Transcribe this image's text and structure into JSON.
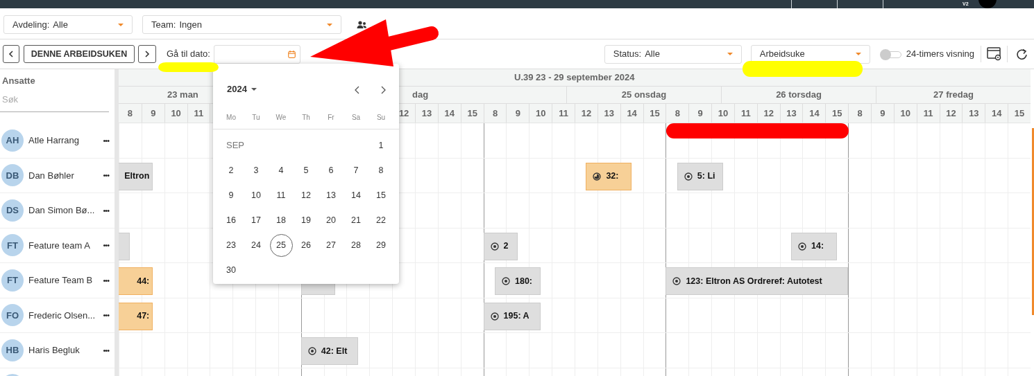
{
  "top_bar": {
    "badge": "V2"
  },
  "filters": [
    {
      "label": "Avdeling:",
      "value": "Alle"
    },
    {
      "label": "Team:",
      "value": "Ingen"
    }
  ],
  "toolbar": {
    "this_week_button": "DENNE ARBEIDSUKEN",
    "goto_label": "Gå til dato:",
    "status": {
      "label": "Status:",
      "value": "Alle"
    },
    "view": {
      "value": "Arbeidsuke"
    },
    "toggle": {
      "label": "24-timers visning",
      "on": false
    }
  },
  "sidebar": {
    "title": "Ansatte",
    "search": {
      "placeholder": "Søk"
    }
  },
  "calendar": {
    "week_title": "U.39 23 - 29 september 2024",
    "days": [
      {
        "label": "23 man",
        "hours": [
          "8",
          "9",
          "10",
          "11"
        ]
      },
      {
        "label": "dag",
        "hours": [
          "12",
          "13",
          "14",
          "15"
        ]
      },
      {
        "label": "25 onsdag",
        "hours": [
          "8",
          "9",
          "10",
          "11",
          "12",
          "13",
          "14",
          "15"
        ]
      },
      {
        "label": "26 torsdag",
        "hours": [
          "8",
          "9",
          "10",
          "11",
          "12",
          "13",
          "14",
          "15"
        ]
      },
      {
        "label": "27 fredag",
        "hours": [
          "8",
          "9",
          "10",
          "11",
          "12",
          "13",
          "14",
          "15"
        ]
      }
    ],
    "rows": [
      {
        "initials": "AH",
        "name": "Atle Harrang",
        "menu": "•••",
        "events": []
      },
      {
        "initials": "DB",
        "name": "Dan Bøhler",
        "menu": "•••",
        "events": [
          {
            "label": "Eltron",
            "kind": "planned"
          },
          {
            "label": "32:",
            "kind": "started"
          },
          {
            "label": "5: Li",
            "kind": "planned"
          }
        ]
      },
      {
        "initials": "DS",
        "name": "Dan Simon Bø...",
        "menu": "•••",
        "events": []
      },
      {
        "initials": "FT",
        "name": "Feature team A",
        "menu": "•••",
        "events": [
          {
            "kind": "planned"
          },
          {
            "label": "2",
            "kind": "planned"
          },
          {
            "label": "14:",
            "kind": "planned"
          }
        ]
      },
      {
        "initials": "FT",
        "name": "Feature Team B",
        "menu": "•••",
        "events": [
          {
            "label": "44:",
            "kind": "started"
          },
          {
            "kind": "planned"
          },
          {
            "label": "180:",
            "kind": "planned"
          },
          {
            "label": "123: Eltron AS Ordreref: Autotest",
            "kind": "planned"
          }
        ]
      },
      {
        "initials": "FO",
        "name": "Frederic Olsen...",
        "menu": "•••",
        "events": [
          {
            "label": "47:",
            "kind": "started"
          },
          {
            "label": "195: A",
            "kind": "planned"
          }
        ]
      },
      {
        "initials": "HB",
        "name": "Haris Begluk",
        "menu": "•••",
        "events": [
          {
            "label": "42: Elt",
            "kind": "planned"
          }
        ]
      }
    ]
  },
  "datepicker": {
    "year": "2024",
    "weekdays": [
      "Mo",
      "Tu",
      "We",
      "Th",
      "Fr",
      "Sa",
      "Su"
    ],
    "month": "SEP",
    "days": [
      {
        "day": "1",
        "today": false
      },
      {
        "day": "2",
        "today": false
      },
      {
        "day": "3",
        "today": false
      },
      {
        "day": "4",
        "today": false
      },
      {
        "day": "5",
        "today": false
      },
      {
        "day": "6",
        "today": false
      },
      {
        "day": "7",
        "today": false
      },
      {
        "day": "8",
        "today": false
      },
      {
        "day": "9",
        "today": false
      },
      {
        "day": "10",
        "today": false
      },
      {
        "day": "11",
        "today": false
      },
      {
        "day": "12",
        "today": false
      },
      {
        "day": "13",
        "today": false
      },
      {
        "day": "14",
        "today": false
      },
      {
        "day": "15",
        "today": false
      },
      {
        "day": "16",
        "today": false
      },
      {
        "day": "17",
        "today": false
      },
      {
        "day": "18",
        "today": false
      },
      {
        "day": "19",
        "today": false
      },
      {
        "day": "20",
        "today": false
      },
      {
        "day": "21",
        "today": false
      },
      {
        "day": "22",
        "today": false
      },
      {
        "day": "23",
        "today": false
      },
      {
        "day": "24",
        "today": false
      },
      {
        "day": "25",
        "today": true
      },
      {
        "day": "26",
        "today": false
      },
      {
        "day": "27",
        "today": false
      },
      {
        "day": "28",
        "today": false
      },
      {
        "day": "29",
        "today": false
      },
      {
        "day": "30",
        "today": false
      }
    ]
  }
}
